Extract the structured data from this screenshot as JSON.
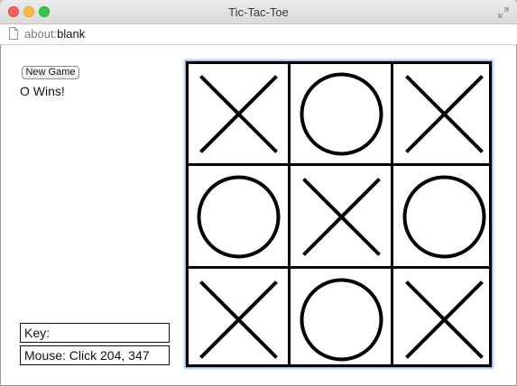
{
  "window": {
    "title": "Tic-Tac-Toe"
  },
  "urlbar": {
    "scheme": "about:",
    "host": "blank"
  },
  "controls": {
    "new_game_label": "New Game"
  },
  "status": "O Wins!",
  "info": {
    "key": "Key:",
    "mouse": "Mouse: Click 204, 347"
  },
  "board": {
    "cells": [
      "X",
      "O",
      "X",
      "O",
      "X",
      "O",
      "X",
      "O",
      "X"
    ]
  },
  "colors": {
    "line": "#000000",
    "focus_ring": "#8fb2e0"
  }
}
